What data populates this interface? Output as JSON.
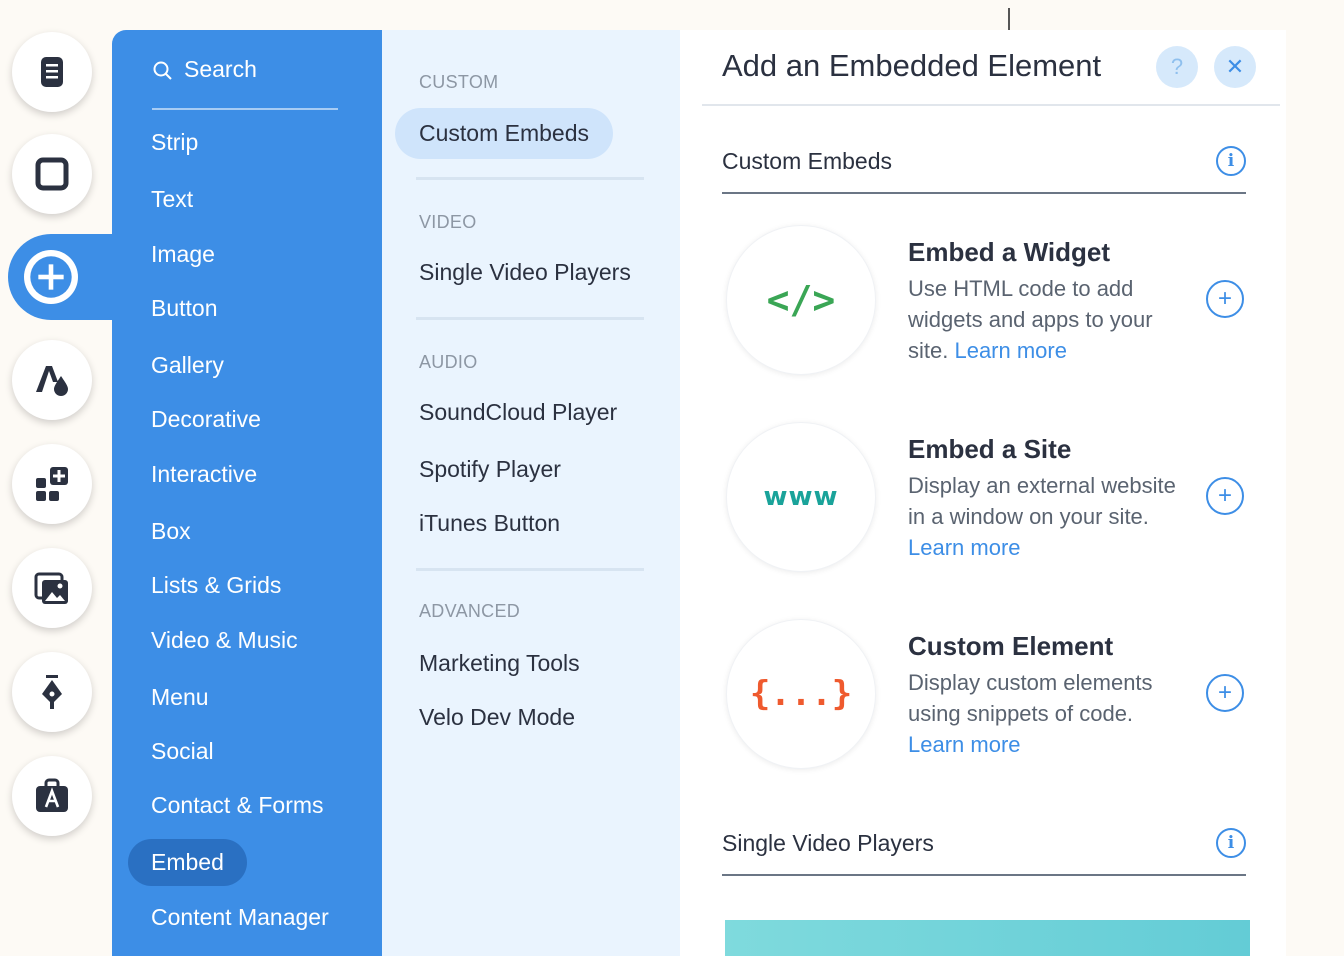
{
  "colors": {
    "accent": "#3d8ee6",
    "accent_dark": "#2a70c2",
    "widget_icon": "#3aa655",
    "site_icon": "#1aa39a",
    "custom_icon": "#ef5a2e"
  },
  "rail": {
    "items": [
      {
        "name": "pages-icon"
      },
      {
        "name": "background-icon"
      },
      {
        "name": "add-icon",
        "active": true
      },
      {
        "name": "theme-icon"
      },
      {
        "name": "apps-icon"
      },
      {
        "name": "media-icon"
      },
      {
        "name": "blog-icon"
      },
      {
        "name": "store-icon"
      }
    ]
  },
  "categories": {
    "search_label": "Search",
    "items": [
      {
        "label": "Strip"
      },
      {
        "label": "Text"
      },
      {
        "label": "Image"
      },
      {
        "label": "Button"
      },
      {
        "label": "Gallery"
      },
      {
        "label": "Decorative"
      },
      {
        "label": "Interactive"
      },
      {
        "label": "Box"
      },
      {
        "label": "Lists & Grids"
      },
      {
        "label": "Video & Music"
      },
      {
        "label": "Menu"
      },
      {
        "label": "Social"
      },
      {
        "label": "Contact & Forms"
      },
      {
        "label": "Embed",
        "active": true
      },
      {
        "label": "Content Manager"
      }
    ]
  },
  "subcategories": {
    "groups": [
      {
        "heading": "CUSTOM",
        "items": [
          {
            "label": "Custom Embeds",
            "active": true
          }
        ]
      },
      {
        "heading": "VIDEO",
        "items": [
          {
            "label": "Single Video Players"
          }
        ]
      },
      {
        "heading": "AUDIO",
        "items": [
          {
            "label": "SoundCloud Player"
          },
          {
            "label": "Spotify Player"
          },
          {
            "label": "iTunes Button"
          }
        ]
      },
      {
        "heading": "ADVANCED",
        "items": [
          {
            "label": "Marketing Tools"
          },
          {
            "label": "Velo Dev Mode"
          }
        ]
      }
    ]
  },
  "main": {
    "title": "Add an Embedded Element",
    "help_label": "?",
    "close_label": "✕",
    "sections": [
      {
        "title": "Custom Embeds",
        "info_label": "i",
        "cards": [
          {
            "icon_text": "</>",
            "title": "Embed a Widget",
            "desc": "Use HTML code to add widgets and apps to your site.",
            "link": "Learn more",
            "add_label": "+"
          },
          {
            "icon_text": "www",
            "title": "Embed a Site",
            "desc": "Display an external website in a window on your site.",
            "link": "Learn more",
            "add_label": "+"
          },
          {
            "icon_text": "{...}",
            "title": "Custom Element",
            "desc": "Display custom elements using snippets of code.",
            "link": "Learn more",
            "add_label": "+"
          }
        ]
      },
      {
        "title": "Single Video Players",
        "info_label": "i"
      }
    ]
  }
}
